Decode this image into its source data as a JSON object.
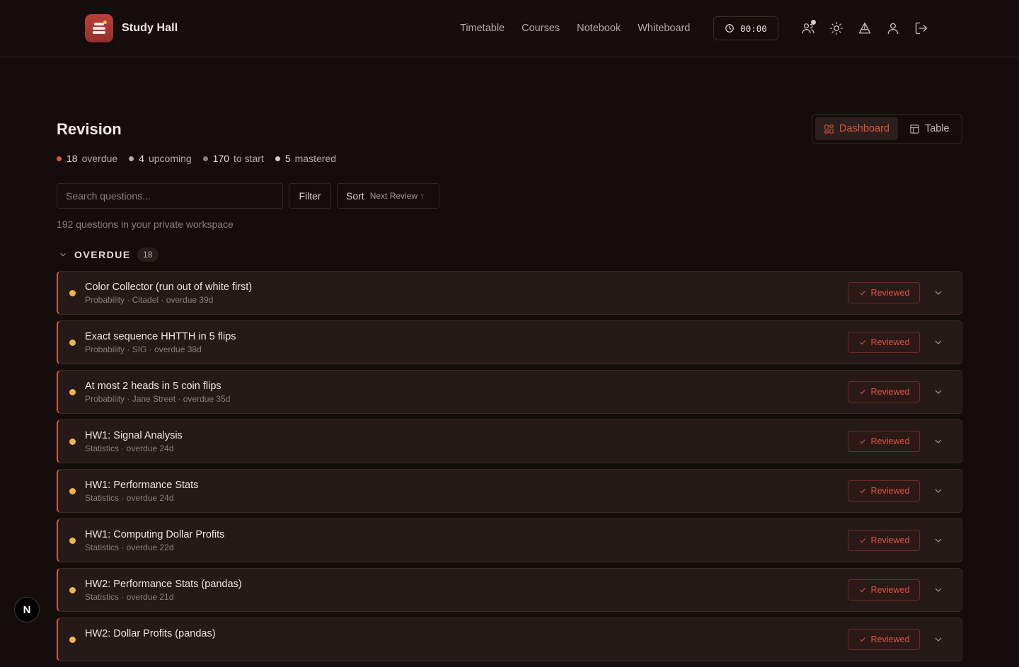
{
  "app": {
    "name": "Study Hall"
  },
  "nav": [
    {
      "label": "Timetable",
      "active": true
    },
    {
      "label": "Courses",
      "active": false
    },
    {
      "label": "Notebook",
      "active": false
    },
    {
      "label": "Whiteboard",
      "active": false
    }
  ],
  "timer": {
    "value": "00:00"
  },
  "header_icons": [
    "users-icon",
    "sun-icon",
    "flask-icon",
    "user-icon",
    "logout-icon"
  ],
  "page": {
    "title": "Revision",
    "stats": [
      {
        "count": "18",
        "label": "overdue",
        "color": "#e0553f"
      },
      {
        "count": "4",
        "label": "upcoming",
        "color": "#b9aaa6"
      },
      {
        "count": "170",
        "label": "to start",
        "color": "#8c7d79"
      },
      {
        "count": "5",
        "label": "mastered",
        "color": "#d9ccc8"
      }
    ],
    "view_toggle": {
      "dashboard": "Dashboard",
      "table": "Table",
      "selected": "Dashboard"
    },
    "search": {
      "placeholder": "Search questions...",
      "value": ""
    },
    "filter_label": "Filter",
    "sort": {
      "label": "Sort",
      "value": "Next Review ↑"
    },
    "count_line": "192 questions in your private workspace"
  },
  "group": {
    "name": "OVERDUE",
    "count": "18",
    "reviewed_label": "Reviewed",
    "items": [
      {
        "title": "Color Collector (run out of white first)",
        "meta": "Probability · Citadel · overdue 39d"
      },
      {
        "title": "Exact sequence HHTTH in 5 flips",
        "meta": "Probability · SIG · overdue 38d"
      },
      {
        "title": "At most 2 heads in 5 coin flips",
        "meta": "Probability · Jane Street · overdue 35d"
      },
      {
        "title": "HW1: Signal Analysis",
        "meta": "Statistics · overdue 24d"
      },
      {
        "title": "HW1: Performance Stats",
        "meta": "Statistics · overdue 24d"
      },
      {
        "title": "HW1: Computing Dollar Profits",
        "meta": "Statistics · overdue 22d"
      },
      {
        "title": "HW2: Performance Stats (pandas)",
        "meta": "Statistics · overdue 21d"
      },
      {
        "title": "HW2: Dollar Profits (pandas)",
        "meta": ""
      }
    ]
  },
  "dev_badge": "N",
  "colors": {
    "accent": "#e0553f",
    "priority": "#f0b54a",
    "background": "#150d0c",
    "card": "#251a18"
  }
}
